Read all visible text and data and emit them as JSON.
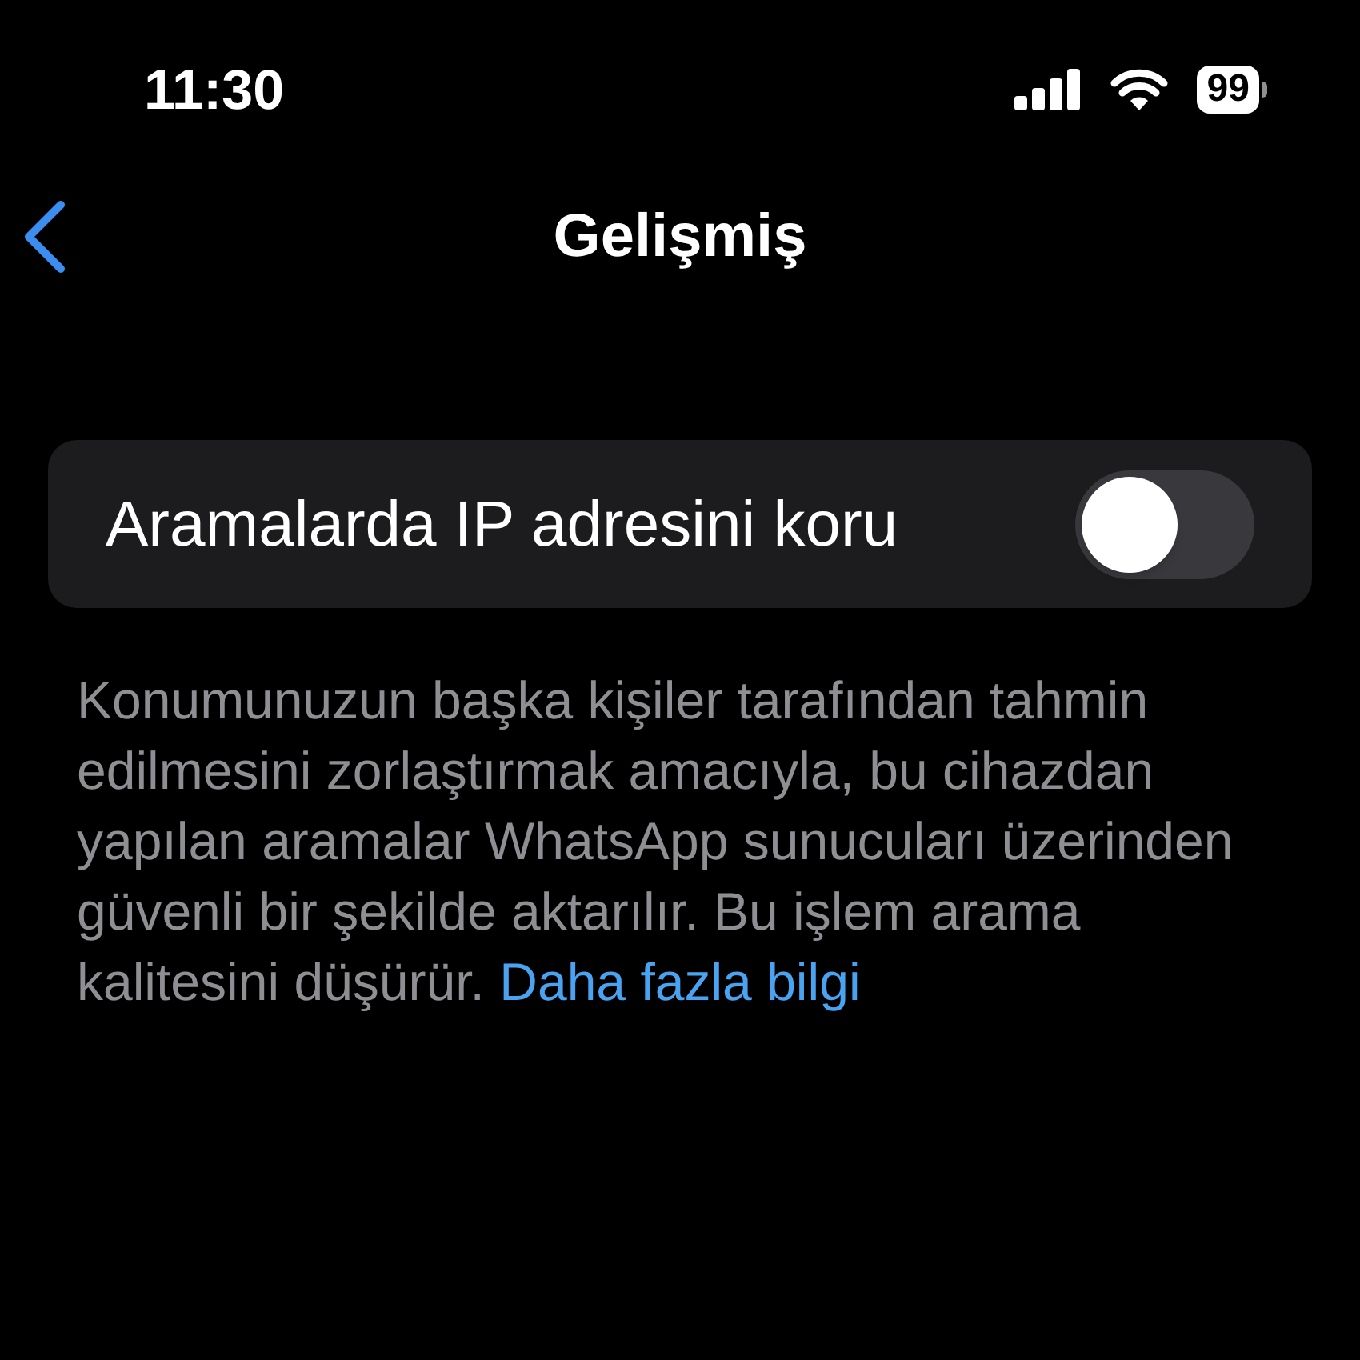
{
  "status_bar": {
    "time": "11:30",
    "battery": "99"
  },
  "nav": {
    "title": "Gelişmiş"
  },
  "settings": [
    {
      "kind": "toggle",
      "label": "Aramalarda IP adresini koru",
      "on": false
    }
  ],
  "footer": {
    "text": "Konumunuzun başka kişiler tarafından tahmin edilmesini zorlaştırmak amacıyla, bu cihazdan yapılan aramalar WhatsApp sunucuları üzerinden güvenli bir şekilde aktarılır. Bu işlem arama kalitesini düşürür.",
    "link": "Daha fazla bilgi"
  }
}
